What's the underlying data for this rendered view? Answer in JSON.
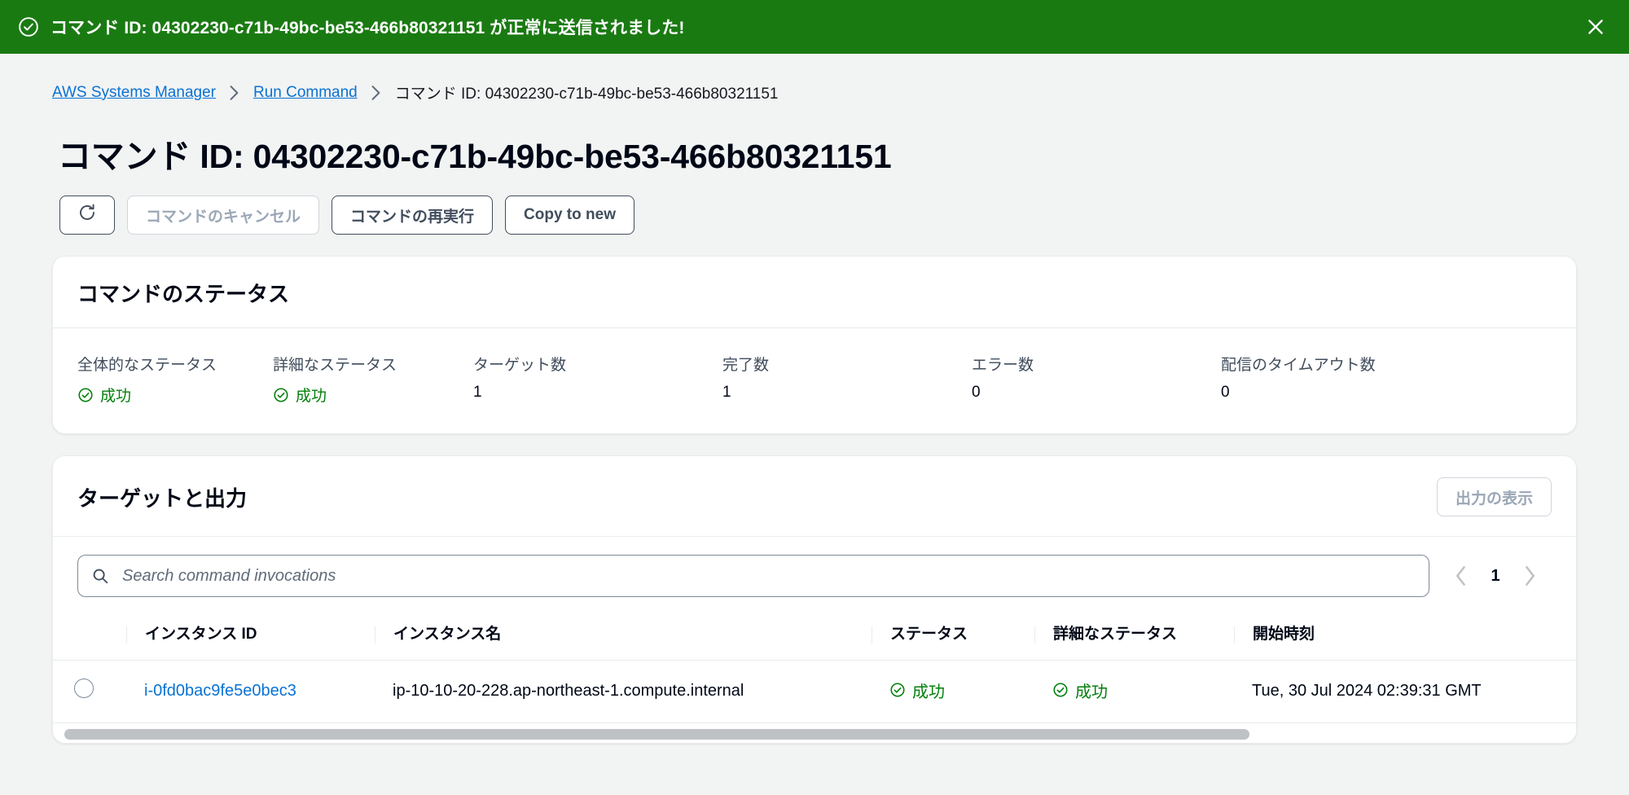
{
  "flash": {
    "icon": "status-success-icon",
    "message": "コマンド ID: 04302230-c71b-49bc-be53-466b80321151 が正常に送信されました!",
    "close_icon": "close-icon",
    "background": "#1a7a12"
  },
  "breadcrumb": {
    "items": [
      {
        "label": "AWS Systems Manager",
        "is_link": true
      },
      {
        "label": "Run Command",
        "is_link": true
      },
      {
        "label": "コマンド ID: 04302230-c71b-49bc-be53-466b80321151",
        "is_link": false
      }
    ],
    "separator_icon": "chevron-right-icon"
  },
  "page": {
    "title": "コマンド ID: 04302230-c71b-49bc-be53-466b80321151"
  },
  "actions": {
    "refresh_icon": "refresh-icon",
    "cancel_label": "コマンドのキャンセル",
    "rerun_label": "コマンドの再実行",
    "copy_to_new_label": "Copy to new"
  },
  "command_status": {
    "title": "コマンドのステータス",
    "metrics": [
      {
        "label": "全体的なステータス",
        "value": "成功",
        "status": "success"
      },
      {
        "label": "詳細なステータス",
        "value": "成功",
        "status": "success"
      },
      {
        "label": "ターゲット数",
        "value": "1",
        "status": "plain"
      },
      {
        "label": "完了数",
        "value": "1",
        "status": "plain"
      },
      {
        "label": "エラー数",
        "value": "0",
        "status": "plain"
      },
      {
        "label": "配信のタイムアウト数",
        "value": "0",
        "status": "plain"
      }
    ]
  },
  "targets_output": {
    "title": "ターゲットと出力",
    "view_output_label": "出力の表示",
    "search": {
      "placeholder": "Search command invocations",
      "value": "",
      "icon": "search-icon"
    },
    "pagination": {
      "prev_icon": "chevron-left-icon",
      "next_icon": "chevron-right-icon",
      "current_page": "1"
    },
    "table": {
      "columns": [
        "インスタンス ID",
        "インスタンス名",
        "ステータス",
        "詳細なステータス",
        "開始時刻"
      ],
      "rows": [
        {
          "instance_id": "i-0fd0bac9fe5e0bec3",
          "instance_name": "ip-10-10-20-228.ap-northeast-1.compute.internal",
          "status": "成功",
          "detailed_status": "成功",
          "start_time": "Tue, 30 Jul 2024 02:39:31 GMT"
        }
      ]
    }
  },
  "colors": {
    "success_green": "#037f0c",
    "banner_green": "#1a7a12",
    "link_blue": "#0972d3"
  }
}
